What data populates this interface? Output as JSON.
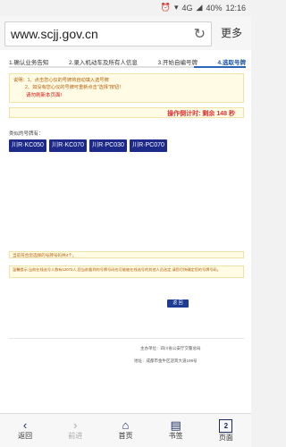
{
  "status": {
    "network": "4G",
    "battery": "40%",
    "time": "12:16"
  },
  "browser": {
    "url": "www.scjj.gov.cn",
    "more_label": "更多"
  },
  "steps": [
    "1.确认业务告知",
    "2.录入机动车及所有人信息",
    "3.开始自编号牌",
    "4.选取号牌"
  ],
  "notice": {
    "line1": "说明：1、点击您心仪的号牌将自动填入选号牌",
    "line2": "2、如没有您心仪的号牌可重新点击\"选择\"按钮！",
    "refresh": "请勿刷新本页面!"
  },
  "countdown": "操作倒计时: 剩余 148 秒",
  "similar_label": "类似的号牌有：",
  "plates": [
    "川R·KC050",
    "川R·KC070",
    "川R·PC030",
    "川R·PC070"
  ],
  "info1": "当前符合您选择的号牌号码共4个。",
  "info2": "温馨提示:当前在线选号人数有12073人,您当前看到的号牌号码也可能被在线选号的其他人员选定,请您尽快确定您的号牌号码。",
  "back_label": "返 回",
  "footer": {
    "org": "主办单位：四川省公安厅交警总局",
    "address": "地址：成都市金牛区迎宾大道199号"
  },
  "nav": [
    "返回",
    "前进",
    "首页",
    "书签",
    "页面"
  ],
  "tab_count": "2"
}
